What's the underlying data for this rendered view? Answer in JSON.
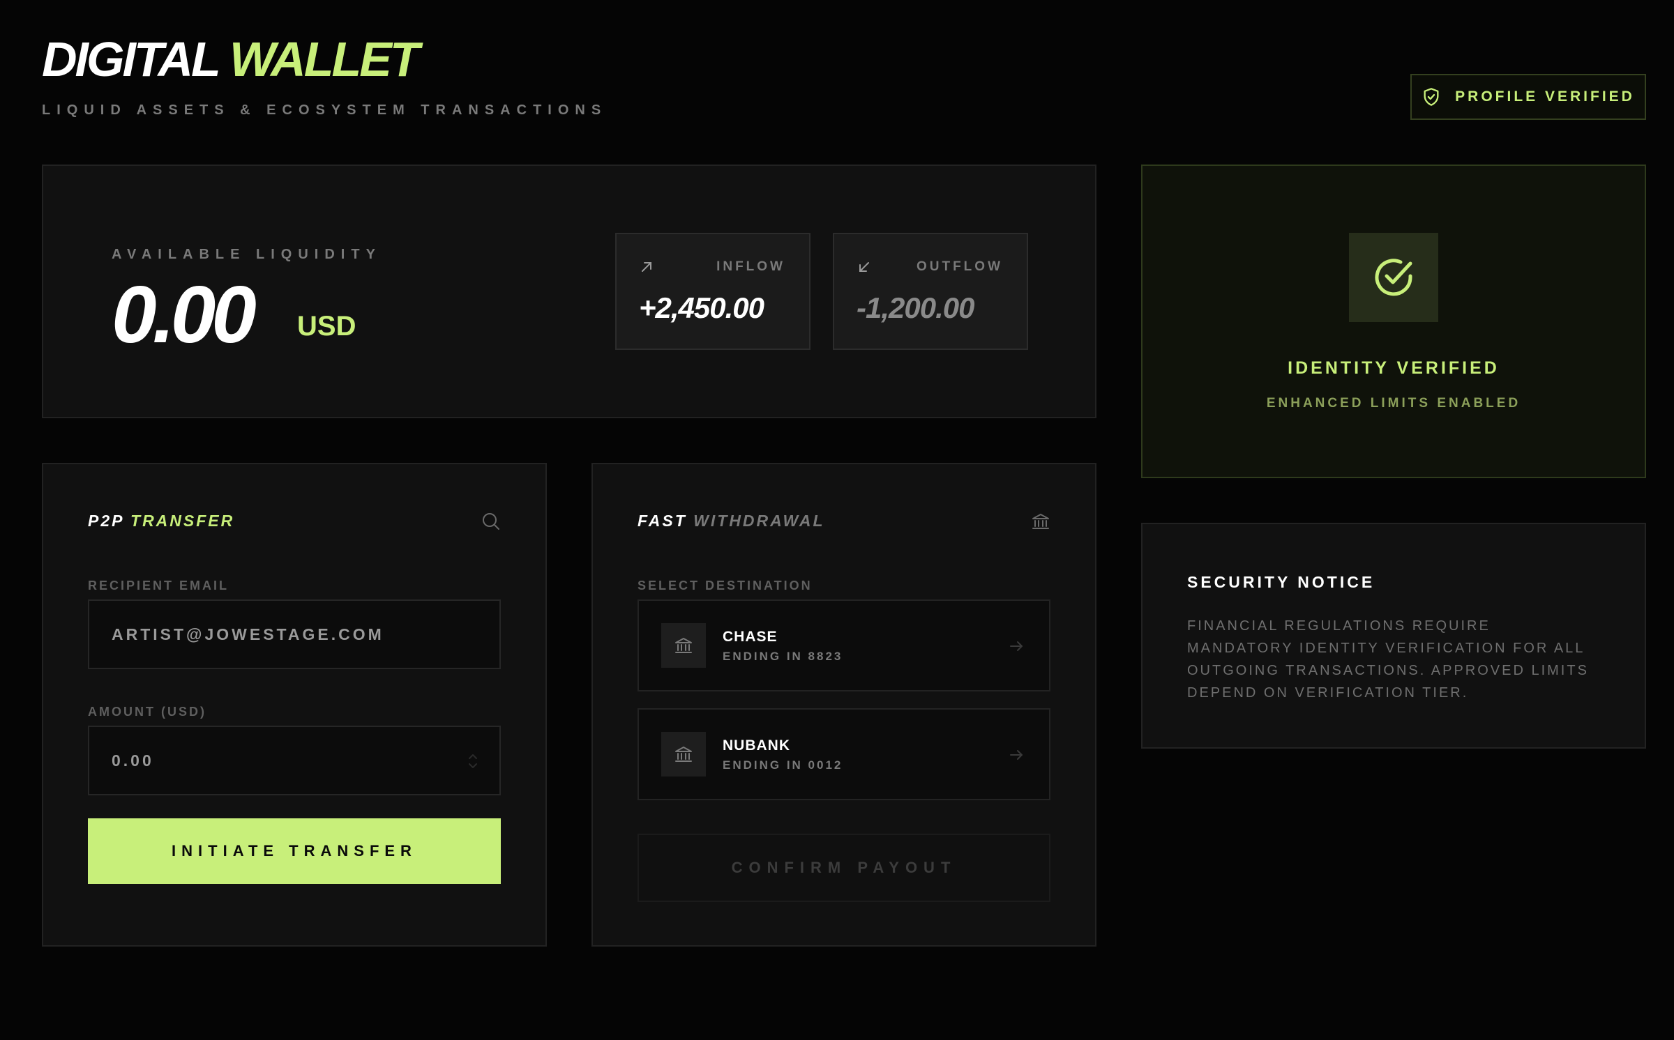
{
  "header": {
    "title_part1": "DIGITAL",
    "title_part2": "WALLET",
    "subtitle": "LIQUID ASSETS & ECOSYSTEM TRANSACTIONS",
    "badge_label": "PROFILE VERIFIED",
    "badge_icon": "shield-check-icon"
  },
  "balance": {
    "label": "AVAILABLE LIQUIDITY",
    "amount": "0.00",
    "currency": "USD",
    "inflow": {
      "label": "INFLOW",
      "value": "+2,450.00",
      "icon": "arrow-up-right-icon"
    },
    "outflow": {
      "label": "OUTFLOW",
      "value": "-1,200.00",
      "icon": "arrow-down-left-icon"
    }
  },
  "identity": {
    "title": "IDENTITY VERIFIED",
    "subtitle": "ENHANCED LIMITS ENABLED",
    "icon": "check-circle-icon"
  },
  "notice": {
    "title": "SECURITY NOTICE",
    "body": "FINANCIAL REGULATIONS REQUIRE MANDATORY IDENTITY VERIFICATION FOR ALL OUTGOING TRANSACTIONS. APPROVED LIMITS DEPEND ON VERIFICATION TIER."
  },
  "p2p": {
    "title_part1": "P2P",
    "title_part2": "TRANSFER",
    "icon": "search-icon",
    "email_label": "RECIPIENT EMAIL",
    "email_value": "ARTIST@JOWESTAGE.COM",
    "amount_label": "AMOUNT (USD)",
    "amount_value": "0.00",
    "button_label": "INITIATE TRANSFER"
  },
  "withdraw": {
    "title_part1": "FAST",
    "title_part2": "WITHDRAWAL",
    "icon": "bank-icon",
    "destination_label": "SELECT DESTINATION",
    "destinations": [
      {
        "name": "CHASE",
        "ending": "ENDING IN 8823"
      },
      {
        "name": "NUBANK",
        "ending": "ENDING IN 0012"
      }
    ],
    "button_label": "CONFIRM PAYOUT"
  },
  "colors": {
    "accent": "#c8ef7a",
    "background": "#050505",
    "panel": "#111111"
  }
}
